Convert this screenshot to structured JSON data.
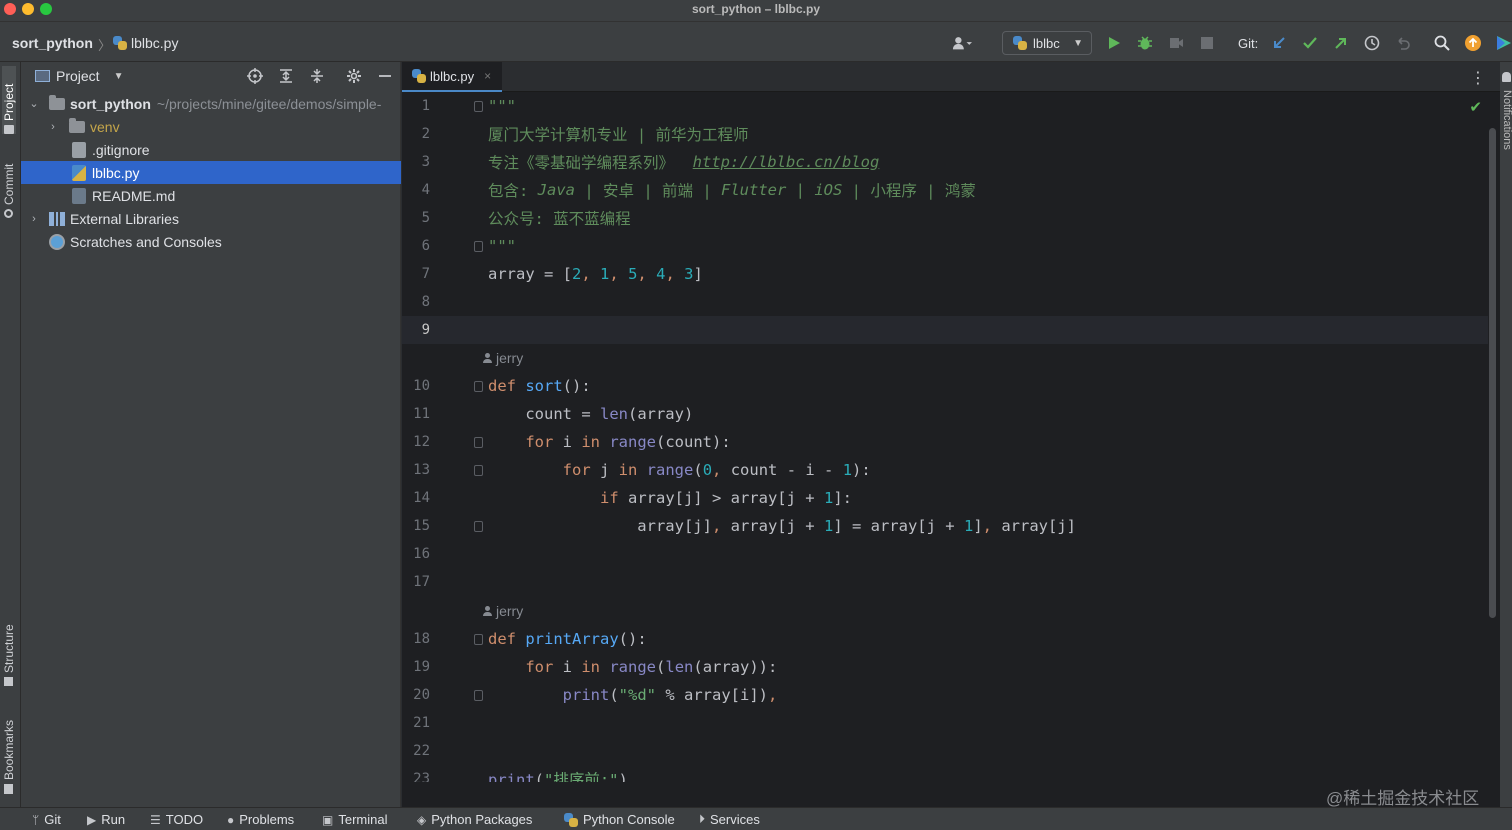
{
  "window": {
    "title": "sort_python – lblbc.py"
  },
  "navbar": {
    "project": "sort_python",
    "file": "lblbc.py",
    "run_config": "lblbc",
    "git_label": "Git:"
  },
  "left_stripe": {
    "project": "Project",
    "commit": "Commit",
    "structure": "Structure",
    "bookmarks": "Bookmarks"
  },
  "right_stripe": {
    "notifications": "Notifications"
  },
  "project_panel": {
    "title": "Project",
    "tree": [
      {
        "label": "sort_python",
        "hint": "~/projects/mine/gitee/demos/simple-"
      },
      {
        "label": "venv"
      },
      {
        "label": ".gitignore"
      },
      {
        "label": "lblbc.py"
      },
      {
        "label": "README.md"
      },
      {
        "label": "External Libraries"
      },
      {
        "label": "Scratches and Consoles"
      }
    ]
  },
  "editor": {
    "tab": "lblbc.py",
    "author_hint": "jerry",
    "line_numbers": [
      "1",
      "2",
      "3",
      "4",
      "5",
      "6",
      "7",
      "8",
      "9",
      "10",
      "11",
      "12",
      "13",
      "14",
      "15",
      "16",
      "17",
      "18",
      "19",
      "20",
      "21",
      "22",
      "23"
    ],
    "lines": {
      "l1": "\"\"\"",
      "l2": "厦门大学计算机专业 | 前华为工程师",
      "l3a": "专注《零基础学编程系列》  ",
      "l3b": "http://lblbc.cn/blog",
      "l4a": "包含: ",
      "l4b": "Java",
      "l4c": " | 安卓 | 前端 | ",
      "l4d": "Flutter",
      "l4e": " | ",
      "l4f": "iOS",
      "l4g": " | 小程序 | 鸿蒙",
      "l5": "公众号: 蓝不蓝编程",
      "l6": "\"\"\"",
      "l7": "array = [2, 1, 5, 4, 3]",
      "l10": "def sort():",
      "l11": "    count = len(array)",
      "l12": "    for i in range(count):",
      "l13": "        for j in range(0, count - i - 1):",
      "l14": "            if array[j] > array[j + 1]:",
      "l15": "                array[j], array[j + 1] = array[j + 1], array[j]",
      "l18": "def printArray():",
      "l19": "    for i in range(len(array)):",
      "l20": "        print(\"%d\" % array[i]),",
      "l23": "print(\"排序前:\")"
    }
  },
  "watermark": "@稀土掘金技术社区",
  "bottombar": {
    "git": "Git",
    "run": "Run",
    "todo": "TODO",
    "problems": "Problems",
    "terminal": "Terminal",
    "python_packages": "Python Packages",
    "python_console": "Python Console",
    "services": "Services"
  },
  "colors": {
    "accent": "#2f65ca",
    "run_green": "#5fb85a",
    "keyword": "#cf8e6d",
    "number": "#2aacb8",
    "function": "#56a8f5",
    "docstring": "#5f8c5c"
  }
}
